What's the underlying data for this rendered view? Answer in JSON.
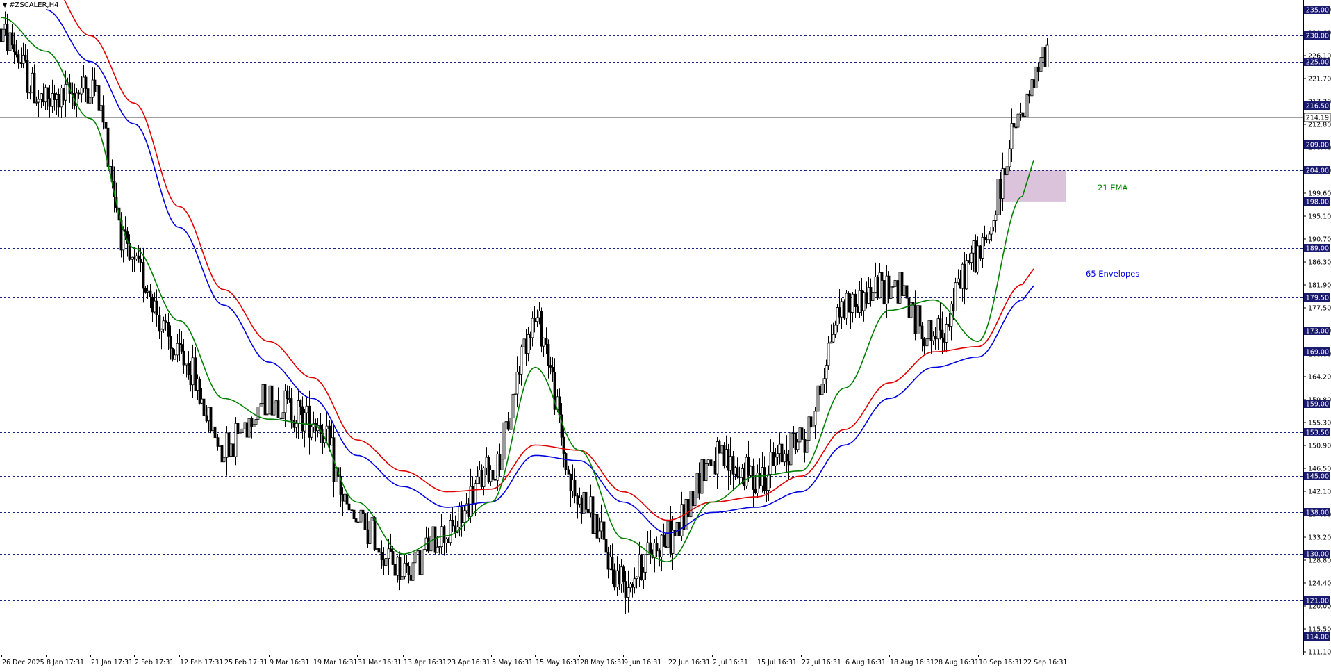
{
  "window": {
    "symbol_title": "#ZSCALER,H4"
  },
  "colors": {
    "background": "#ffffff",
    "candle": "#000000",
    "ema21": "#008000",
    "envelope_upper": "#e00000",
    "envelope_lower": "#0000e0",
    "level_line": "#1a237e",
    "level_tag_bg": "#1a1a6e",
    "zone_fill": "#d8bcd8"
  },
  "annotations": {
    "ema_label": "21 EMA",
    "envelope_label": "65 Envelopes"
  },
  "chart_data": {
    "type": "candlestick",
    "symbol": "#ZSCALER",
    "timeframe": "H4",
    "ylim": [
      109.0,
      237.0
    ],
    "y_ticks": [
      "235.00",
      "230.60",
      "226.10",
      "221.70",
      "217.30",
      "212.80",
      "208.40",
      "204.00",
      "199.60",
      "195.10",
      "190.70",
      "186.30",
      "181.90",
      "177.50",
      "173.00",
      "168.60",
      "164.20",
      "159.80",
      "155.30",
      "150.90",
      "146.50",
      "142.10",
      "137.60",
      "133.20",
      "128.80",
      "124.40",
      "120.00",
      "115.50",
      "111.10"
    ],
    "x_ticks": [
      "26 Dec 2025",
      "8 Jan 17:31",
      "21 Jan 17:31",
      "2 Feb 17:31",
      "12 Feb 17:31",
      "25 Feb 17:31",
      "9 Mar 16:31",
      "19 Mar 16:31",
      "31 Mar 16:31",
      "13 Apr 16:31",
      "23 Apr 16:31",
      "5 May 16:31",
      "15 May 16:31",
      "28 May 16:31",
      "9 Jun 16:31",
      "22 Jun 16:31",
      "2 Jul 16:31",
      "15 Jul 16:31",
      "27 Jul 16:31",
      "6 Aug 16:31",
      "18 Aug 16:31",
      "28 Aug 16:31",
      "10 Sep 16:31",
      "22 Sep 16:31"
    ],
    "horizontal_levels": [
      "235.00",
      "230.00",
      "225.00",
      "216.50",
      "209.00",
      "204.00",
      "198.00",
      "189.00",
      "179.50",
      "173.00",
      "169.00",
      "159.00",
      "153.50",
      "145.00",
      "138.00",
      "130.00",
      "121.00",
      "114.00"
    ],
    "current_price": "214.19",
    "zone": {
      "from_price": 198.0,
      "to_price": 204.0,
      "start_date": "10 Sep",
      "end_date": "26 Sep"
    },
    "price_anchors": [
      [
        "26 Dec 2025",
        230
      ],
      [
        "8 Jan 17:31",
        217
      ],
      [
        "21 Jan 17:31",
        220
      ],
      [
        "2 Feb 17:31",
        185
      ],
      [
        "12 Feb 17:31",
        168
      ],
      [
        "25 Feb 17:31",
        151
      ],
      [
        "9 Mar 16:31",
        160
      ],
      [
        "19 Mar 16:31",
        156
      ],
      [
        "31 Mar 16:31",
        136
      ],
      [
        "13 Apr 16:31",
        127
      ],
      [
        "23 Apr 16:31",
        134
      ],
      [
        "5 May 16:31",
        146
      ],
      [
        "15 May 16:31",
        175
      ],
      [
        "28 May 16:31",
        140
      ],
      [
        "9 Jun 16:31",
        125
      ],
      [
        "22 Jun 16:31",
        133
      ],
      [
        "2 Jul 16:31",
        148
      ],
      [
        "15 Jul 16:31",
        145
      ],
      [
        "27 Jul 16:31",
        152
      ],
      [
        "6 Aug 16:31",
        178
      ],
      [
        "18 Aug 16:31",
        182
      ],
      [
        "28 Aug 16:31",
        172
      ],
      [
        "10 Sep 16:31",
        188
      ],
      [
        "22 Sep 16:31",
        214
      ]
    ],
    "ema21_anchors": [
      [
        "26 Dec 2025",
        233.5
      ],
      [
        "8 Jan 17:31",
        227
      ],
      [
        "21 Jan 17:31",
        214
      ],
      [
        "2 Feb 17:31",
        189
      ],
      [
        "12 Feb 17:31",
        175
      ],
      [
        "25 Feb 17:31",
        160
      ],
      [
        "9 Mar 16:31",
        156
      ],
      [
        "19 Mar 16:31",
        155
      ],
      [
        "31 Mar 16:31",
        140
      ],
      [
        "13 Apr 16:31",
        130
      ],
      [
        "23 Apr 16:31",
        133.5
      ],
      [
        "5 May 16:31",
        140
      ],
      [
        "15 May 16:31",
        166
      ],
      [
        "28 May 16:31",
        150
      ],
      [
        "9 Jun 16:31",
        133
      ],
      [
        "22 Jun 16:31",
        128.5
      ],
      [
        "2 Jul 16:31",
        140
      ],
      [
        "15 Jul 16:31",
        145
      ],
      [
        "27 Jul 16:31",
        146
      ],
      [
        "6 Aug 16:31",
        162
      ],
      [
        "18 Aug 16:31",
        177
      ],
      [
        "28 Aug 16:31",
        179
      ],
      [
        "10 Sep 16:31",
        171
      ],
      [
        "22 Sep 16:31",
        199
      ]
    ],
    "envelope_upper_anchors": [
      [
        "8 Jan 17:31",
        241
      ],
      [
        "21 Jan 17:31",
        230
      ],
      [
        "2 Feb 17:31",
        217
      ],
      [
        "12 Feb 17:31",
        197
      ],
      [
        "25 Feb 17:31",
        181
      ],
      [
        "9 Mar 16:31",
        171
      ],
      [
        "19 Mar 16:31",
        164
      ],
      [
        "31 Mar 16:31",
        152
      ],
      [
        "13 Apr 16:31",
        146
      ],
      [
        "23 Apr 16:31",
        142
      ],
      [
        "5 May 16:31",
        142.5
      ],
      [
        "15 May 16:31",
        151
      ],
      [
        "28 May 16:31",
        150
      ],
      [
        "9 Jun 16:31",
        142
      ],
      [
        "22 Jun 16:31",
        136.5
      ],
      [
        "2 Jul 16:31",
        140
      ],
      [
        "15 Jul 16:31",
        141
      ],
      [
        "27 Jul 16:31",
        145
      ],
      [
        "6 Aug 16:31",
        154
      ],
      [
        "18 Aug 16:31",
        163
      ],
      [
        "28 Aug 16:31",
        169
      ],
      [
        "10 Sep 16:31",
        170
      ],
      [
        "22 Sep 16:31",
        182
      ]
    ],
    "envelope_lower_anchors": [
      [
        "8 Jan 17:31",
        235
      ],
      [
        "21 Jan 17:31",
        225
      ],
      [
        "2 Feb 17:31",
        213
      ],
      [
        "12 Feb 17:31",
        193
      ],
      [
        "25 Feb 17:31",
        178
      ],
      [
        "9 Mar 16:31",
        167
      ],
      [
        "19 Mar 16:31",
        160
      ],
      [
        "31 Mar 16:31",
        149
      ],
      [
        "13 Apr 16:31",
        143
      ],
      [
        "23 Apr 16:31",
        139
      ],
      [
        "5 May 16:31",
        140
      ],
      [
        "15 May 16:31",
        149
      ],
      [
        "28 May 16:31",
        148
      ],
      [
        "9 Jun 16:31",
        140
      ],
      [
        "22 Jun 16:31",
        134
      ],
      [
        "2 Jul 16:31",
        138
      ],
      [
        "15 Jul 16:31",
        139
      ],
      [
        "27 Jul 16:31",
        142
      ],
      [
        "6 Aug 16:31",
        151
      ],
      [
        "18 Aug 16:31",
        160
      ],
      [
        "28 Aug 16:31",
        166
      ],
      [
        "10 Sep 16:31",
        168
      ],
      [
        "22 Sep 16:31",
        179
      ]
    ]
  }
}
